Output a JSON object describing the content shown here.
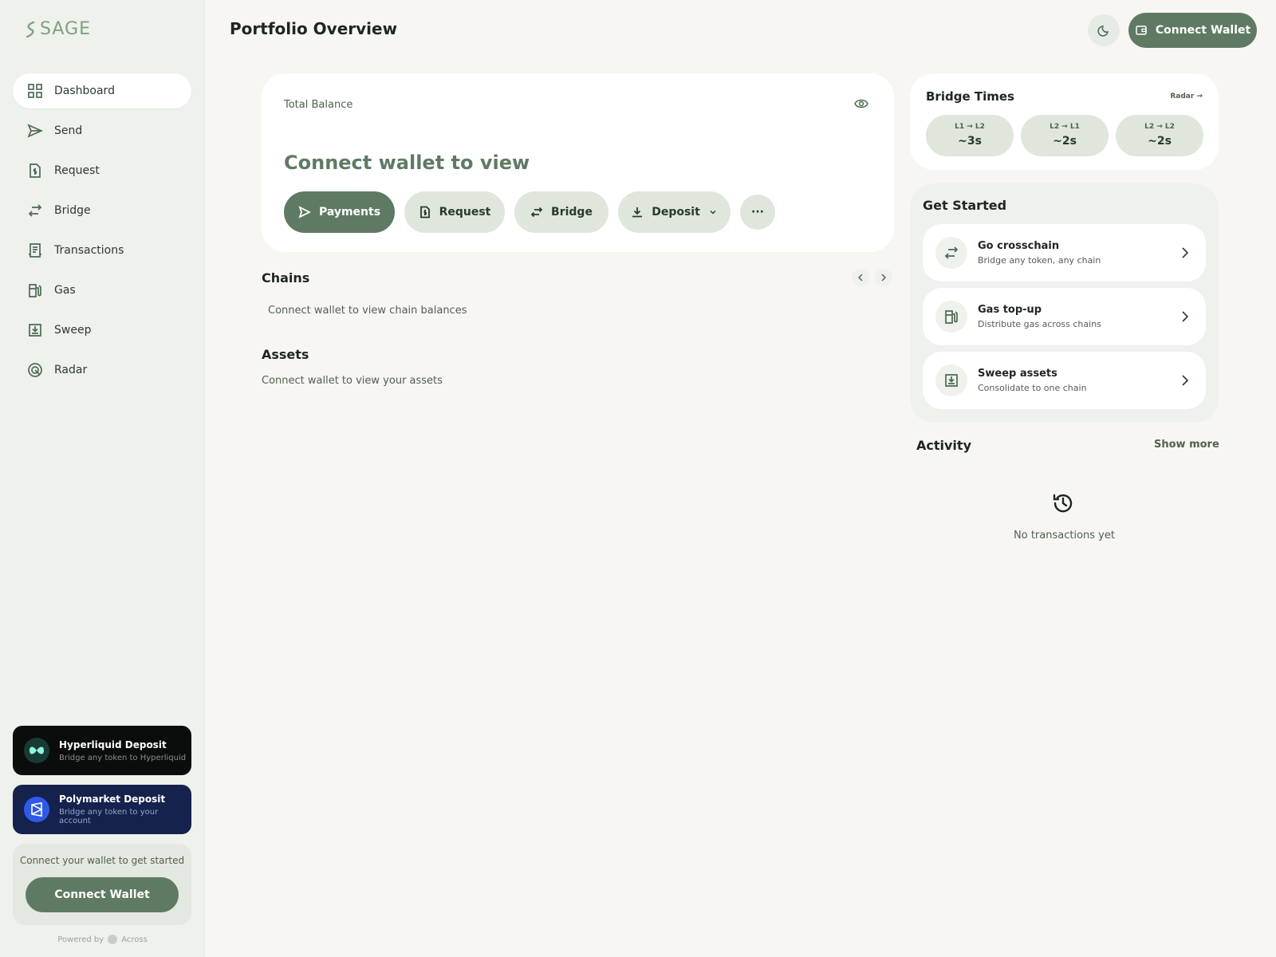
{
  "brand": {
    "name": "SAGE",
    "accent": "#5f7a63",
    "logo_color": "#7da27f"
  },
  "header": {
    "title": "Portfolio Overview",
    "connect_label": "Connect Wallet",
    "theme_icon": "moon-icon"
  },
  "sidebar": {
    "items": [
      {
        "label": "Dashboard",
        "icon": "grid-icon",
        "active": true
      },
      {
        "label": "Send",
        "icon": "send-icon"
      },
      {
        "label": "Request",
        "icon": "invoice-icon"
      },
      {
        "label": "Bridge",
        "icon": "arrows-swap-icon"
      },
      {
        "label": "Transactions",
        "icon": "receipt-icon"
      },
      {
        "label": "Gas",
        "icon": "fuel-icon"
      },
      {
        "label": "Sweep",
        "icon": "tray-download-icon"
      },
      {
        "label": "Radar",
        "icon": "radar-icon"
      }
    ],
    "promos": [
      {
        "title": "Hyperliquid Deposit",
        "subtitle": "Bridge any token to Hyperliquid",
        "bg": "#0b0d0c"
      },
      {
        "title": "Polymarket Deposit",
        "subtitle": "Bridge any token to your account",
        "bg": "#15224d"
      }
    ],
    "connect": {
      "text": "Connect your wallet to get started",
      "button": "Connect Wallet"
    },
    "powered_by": "Powered by",
    "powered_name": "Across"
  },
  "balance": {
    "label": "Total Balance",
    "value": "Connect wallet to view",
    "actions": [
      {
        "label": "Payments",
        "icon": "send-icon"
      },
      {
        "label": "Request",
        "icon": "invoice-icon"
      },
      {
        "label": "Bridge",
        "icon": "arrows-swap-icon"
      },
      {
        "label": "Deposit",
        "icon": "download-icon"
      }
    ],
    "more_label": "···"
  },
  "chains": {
    "title": "Chains",
    "empty": "Connect wallet to view chain balances"
  },
  "assets": {
    "title": "Assets",
    "empty": "Connect wallet to view your assets"
  },
  "bridge_times": {
    "title": "Bridge Times",
    "link": "Radar →",
    "routes": [
      {
        "route": "L1 → L2",
        "time": "~3s"
      },
      {
        "route": "L2 → L1",
        "time": "~2s"
      },
      {
        "route": "L2 → L2",
        "time": "~2s"
      }
    ]
  },
  "get_started": {
    "title": "Get Started",
    "items": [
      {
        "title": "Go crosschain",
        "subtitle": "Bridge any token, any chain",
        "icon": "arrows-swap-icon"
      },
      {
        "title": "Gas top-up",
        "subtitle": "Distribute gas across chains",
        "icon": "fuel-icon"
      },
      {
        "title": "Sweep assets",
        "subtitle": "Consolidate to one chain",
        "icon": "tray-download-icon"
      }
    ]
  },
  "activity": {
    "title": "Activity",
    "show_more": "Show more",
    "empty": "No transactions yet"
  }
}
